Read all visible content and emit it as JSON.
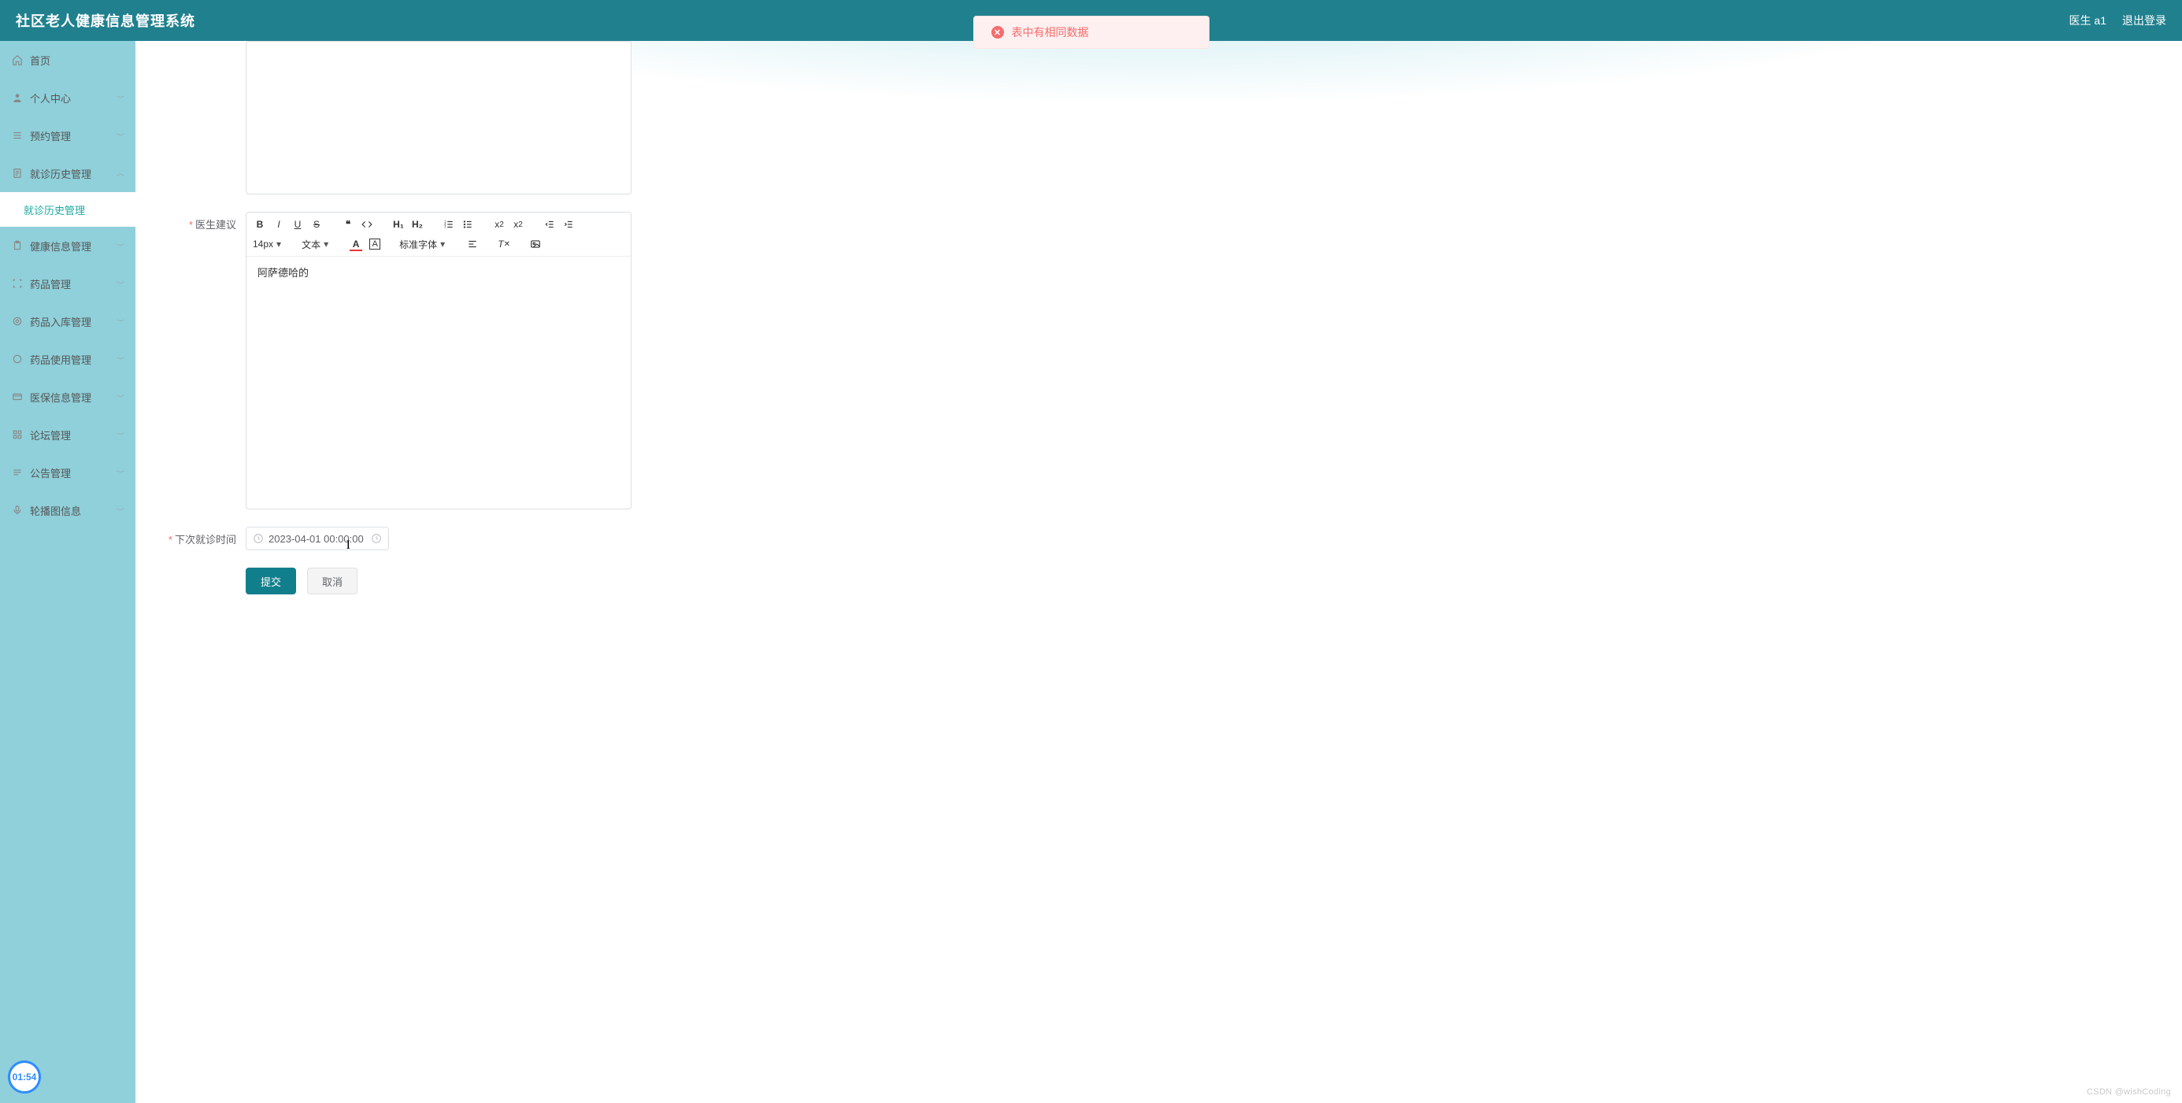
{
  "header": {
    "title": "社区老人健康信息管理系统",
    "user": "医生 a1",
    "logout": "退出登录"
  },
  "toast": {
    "text": "表中有相同数据"
  },
  "sidebar": {
    "items": [
      {
        "icon": "home",
        "label": "首页",
        "expandable": false
      },
      {
        "icon": "person",
        "label": "个人中心",
        "expandable": true
      },
      {
        "icon": "list",
        "label": "预约管理",
        "expandable": true
      },
      {
        "icon": "doc",
        "label": "就诊历史管理",
        "expandable": true,
        "open": true,
        "children": [
          {
            "label": "就诊历史管理"
          }
        ]
      },
      {
        "icon": "clipboard",
        "label": "健康信息管理",
        "expandable": true
      },
      {
        "icon": "scan",
        "label": "药品管理",
        "expandable": true
      },
      {
        "icon": "target",
        "label": "药品入库管理",
        "expandable": true
      },
      {
        "icon": "circle",
        "label": "药品使用管理",
        "expandable": true
      },
      {
        "icon": "card",
        "label": "医保信息管理",
        "expandable": true
      },
      {
        "icon": "grid",
        "label": "论坛管理",
        "expandable": true
      },
      {
        "icon": "bars",
        "label": "公告管理",
        "expandable": true
      },
      {
        "icon": "mic",
        "label": "轮播图信息",
        "expandable": true
      }
    ]
  },
  "form": {
    "advice_label": "医生建议",
    "advice_content": "阿萨德哈的",
    "editor": {
      "font_size": "14px",
      "font_kind": "文本",
      "font_family": "标准字体"
    },
    "next_time_label": "下次就诊时间",
    "next_time_value": "2023-04-01 00:00:00"
  },
  "buttons": {
    "submit": "提交",
    "cancel": "取消"
  },
  "floater": "01:54",
  "watermark": "CSDN @wishCoding"
}
